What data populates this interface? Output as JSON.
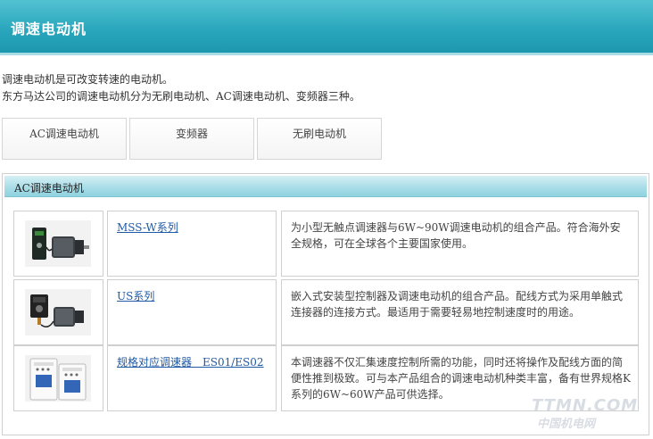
{
  "banner": {
    "title": "调速电动机"
  },
  "intro": {
    "line1": "调速电动机是可改变转速的电动机。",
    "line2": "东方马达公司的调速电动机分为无刷电动机、AC调速电动机、变频器三种。"
  },
  "tabs": [
    {
      "label": "AC调速电动机"
    },
    {
      "label": "变频器"
    },
    {
      "label": "无刷电动机"
    }
  ],
  "section": {
    "title": "AC调速电动机",
    "products": [
      {
        "name": "MSS-W系列",
        "description": "为小型无触点调速器与6W~90W调速电动机的组合产品。符合海外安全规格，可在全球各个主要国家使用。",
        "image_icon": "motor-with-controller-icon"
      },
      {
        "name": "US系列",
        "description": "嵌入式安装型控制器及调速电动机的组合产品。配线方式为采用单触式连接器的连接方式。最适用于需要轻易地控制速度时的用途。",
        "image_icon": "motor-with-panel-controller-icon"
      },
      {
        "name": "规格对应调速器　ES01/ES02",
        "description": "本调速器不仅汇集速度控制所需的功能，同时还将操作及配线方面的简便性推到极致。可与本产品组合的调速电动机种类丰富，备有世界规格K系列的6W~60W产品可供选择。",
        "image_icon": "speed-controller-units-icon"
      }
    ]
  },
  "watermark": {
    "line1": "TTMN.COM",
    "line2": "中国机电网"
  },
  "colors": {
    "banner": "#2aa7bd",
    "link": "#1f5aa6",
    "section_header": "#a6dce7"
  }
}
